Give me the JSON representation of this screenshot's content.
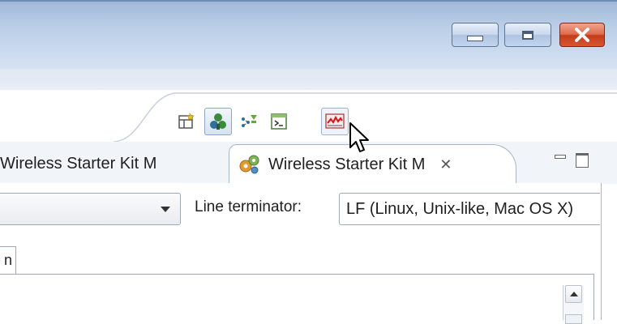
{
  "window": {
    "controls": {
      "minimize_icon": "minimize-icon",
      "maximize_icon": "maximize-icon",
      "close_icon": "close-icon"
    }
  },
  "toolbar": {
    "buttons": [
      {
        "icon": "open-perspective-icon",
        "state": "normal"
      },
      {
        "icon": "perspective-tree-icon",
        "state": "pressed"
      },
      {
        "icon": "debug-perspective-icon",
        "state": "normal"
      },
      {
        "icon": "console-perspective-icon",
        "state": "normal"
      },
      {
        "icon": "energy-profiler-icon",
        "state": "hover"
      }
    ]
  },
  "tabs": {
    "left_tab_label": "Wireless Starter Kit M",
    "active_tab_label": "Wireless Starter Kit M",
    "active_tab_icon": "gears-icon",
    "active_tab_close": "✕"
  },
  "connection_panel": {
    "line_terminator_label": "Line terminator:",
    "line_terminator_value": "LF  (Linux, Unix-like, Mac OS X)",
    "subtab_fragment": "n"
  },
  "colors": {
    "titlebar": "#b9cde6",
    "close_button": "#d9552f",
    "tab_border": "#a9b6c7"
  }
}
